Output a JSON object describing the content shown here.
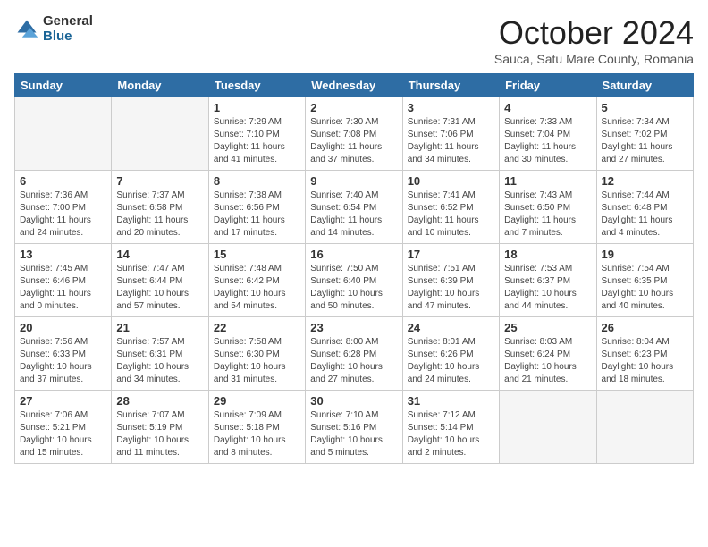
{
  "header": {
    "logo_general": "General",
    "logo_blue": "Blue",
    "month_title": "October 2024",
    "subtitle": "Sauca, Satu Mare County, Romania"
  },
  "days_of_week": [
    "Sunday",
    "Monday",
    "Tuesday",
    "Wednesday",
    "Thursday",
    "Friday",
    "Saturday"
  ],
  "weeks": [
    [
      {
        "day": "",
        "info": ""
      },
      {
        "day": "",
        "info": ""
      },
      {
        "day": "1",
        "info": "Sunrise: 7:29 AM\nSunset: 7:10 PM\nDaylight: 11 hours and 41 minutes."
      },
      {
        "day": "2",
        "info": "Sunrise: 7:30 AM\nSunset: 7:08 PM\nDaylight: 11 hours and 37 minutes."
      },
      {
        "day": "3",
        "info": "Sunrise: 7:31 AM\nSunset: 7:06 PM\nDaylight: 11 hours and 34 minutes."
      },
      {
        "day": "4",
        "info": "Sunrise: 7:33 AM\nSunset: 7:04 PM\nDaylight: 11 hours and 30 minutes."
      },
      {
        "day": "5",
        "info": "Sunrise: 7:34 AM\nSunset: 7:02 PM\nDaylight: 11 hours and 27 minutes."
      }
    ],
    [
      {
        "day": "6",
        "info": "Sunrise: 7:36 AM\nSunset: 7:00 PM\nDaylight: 11 hours and 24 minutes."
      },
      {
        "day": "7",
        "info": "Sunrise: 7:37 AM\nSunset: 6:58 PM\nDaylight: 11 hours and 20 minutes."
      },
      {
        "day": "8",
        "info": "Sunrise: 7:38 AM\nSunset: 6:56 PM\nDaylight: 11 hours and 17 minutes."
      },
      {
        "day": "9",
        "info": "Sunrise: 7:40 AM\nSunset: 6:54 PM\nDaylight: 11 hours and 14 minutes."
      },
      {
        "day": "10",
        "info": "Sunrise: 7:41 AM\nSunset: 6:52 PM\nDaylight: 11 hours and 10 minutes."
      },
      {
        "day": "11",
        "info": "Sunrise: 7:43 AM\nSunset: 6:50 PM\nDaylight: 11 hours and 7 minutes."
      },
      {
        "day": "12",
        "info": "Sunrise: 7:44 AM\nSunset: 6:48 PM\nDaylight: 11 hours and 4 minutes."
      }
    ],
    [
      {
        "day": "13",
        "info": "Sunrise: 7:45 AM\nSunset: 6:46 PM\nDaylight: 11 hours and 0 minutes."
      },
      {
        "day": "14",
        "info": "Sunrise: 7:47 AM\nSunset: 6:44 PM\nDaylight: 10 hours and 57 minutes."
      },
      {
        "day": "15",
        "info": "Sunrise: 7:48 AM\nSunset: 6:42 PM\nDaylight: 10 hours and 54 minutes."
      },
      {
        "day": "16",
        "info": "Sunrise: 7:50 AM\nSunset: 6:40 PM\nDaylight: 10 hours and 50 minutes."
      },
      {
        "day": "17",
        "info": "Sunrise: 7:51 AM\nSunset: 6:39 PM\nDaylight: 10 hours and 47 minutes."
      },
      {
        "day": "18",
        "info": "Sunrise: 7:53 AM\nSunset: 6:37 PM\nDaylight: 10 hours and 44 minutes."
      },
      {
        "day": "19",
        "info": "Sunrise: 7:54 AM\nSunset: 6:35 PM\nDaylight: 10 hours and 40 minutes."
      }
    ],
    [
      {
        "day": "20",
        "info": "Sunrise: 7:56 AM\nSunset: 6:33 PM\nDaylight: 10 hours and 37 minutes."
      },
      {
        "day": "21",
        "info": "Sunrise: 7:57 AM\nSunset: 6:31 PM\nDaylight: 10 hours and 34 minutes."
      },
      {
        "day": "22",
        "info": "Sunrise: 7:58 AM\nSunset: 6:30 PM\nDaylight: 10 hours and 31 minutes."
      },
      {
        "day": "23",
        "info": "Sunrise: 8:00 AM\nSunset: 6:28 PM\nDaylight: 10 hours and 27 minutes."
      },
      {
        "day": "24",
        "info": "Sunrise: 8:01 AM\nSunset: 6:26 PM\nDaylight: 10 hours and 24 minutes."
      },
      {
        "day": "25",
        "info": "Sunrise: 8:03 AM\nSunset: 6:24 PM\nDaylight: 10 hours and 21 minutes."
      },
      {
        "day": "26",
        "info": "Sunrise: 8:04 AM\nSunset: 6:23 PM\nDaylight: 10 hours and 18 minutes."
      }
    ],
    [
      {
        "day": "27",
        "info": "Sunrise: 7:06 AM\nSunset: 5:21 PM\nDaylight: 10 hours and 15 minutes."
      },
      {
        "day": "28",
        "info": "Sunrise: 7:07 AM\nSunset: 5:19 PM\nDaylight: 10 hours and 11 minutes."
      },
      {
        "day": "29",
        "info": "Sunrise: 7:09 AM\nSunset: 5:18 PM\nDaylight: 10 hours and 8 minutes."
      },
      {
        "day": "30",
        "info": "Sunrise: 7:10 AM\nSunset: 5:16 PM\nDaylight: 10 hours and 5 minutes."
      },
      {
        "day": "31",
        "info": "Sunrise: 7:12 AM\nSunset: 5:14 PM\nDaylight: 10 hours and 2 minutes."
      },
      {
        "day": "",
        "info": ""
      },
      {
        "day": "",
        "info": ""
      }
    ]
  ]
}
